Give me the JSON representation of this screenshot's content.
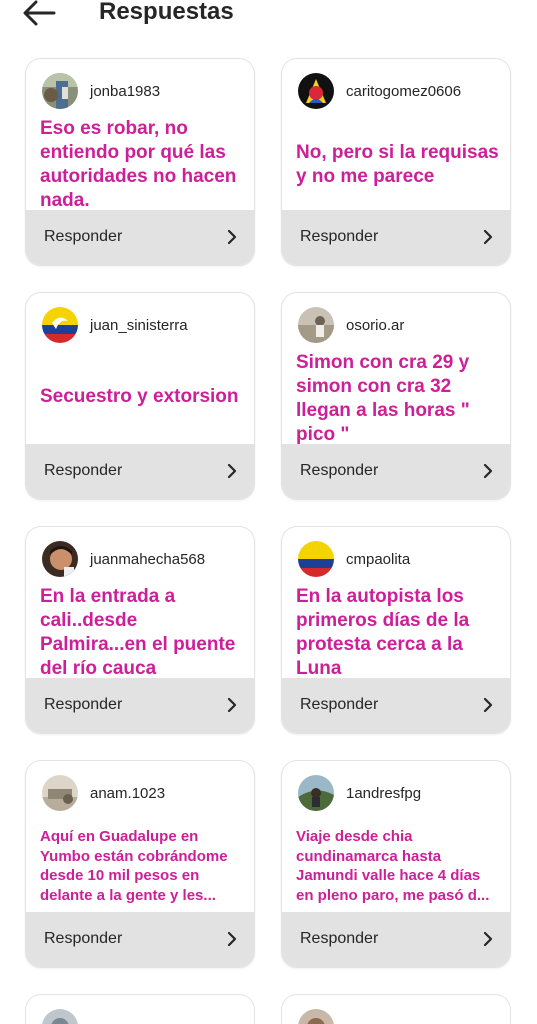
{
  "header": {
    "title": "Respuestas",
    "back_icon": "arrow-left-icon"
  },
  "reply_label": "Responder",
  "accent_color": "#cc1f98",
  "cards": [
    {
      "username": "jonba1983",
      "text": "Eso es robar, no entiendo por qué las autoridades no hacen nada."
    },
    {
      "username": "caritogomez0606",
      "text": "No, pero si la requisas y no me parece"
    },
    {
      "username": "juan_sinisterra",
      "text": "Secuestro y extorsion"
    },
    {
      "username": "osorio.ar",
      "text": "Simon con cra 29 y simon con cra 32 llegan a las horas \" pico \""
    },
    {
      "username": "juanmahecha568",
      "text": "En la entrada a cali..desde Palmira...en el puente del río cauca"
    },
    {
      "username": "cmpaolita",
      "text": "En la autopista los primeros días de la protesta cerca a la Luna"
    },
    {
      "username": "anam.1023",
      "text": "Aquí en Guadalupe en Yumbo están  cobrándome desde 10 mil pesos en delante a la gente y les..."
    },
    {
      "username": "1andresfpg",
      "text": "Viaje desde chia cundinamarca hasta Jamundi valle hace 4 días en pleno paro, me pasó d..."
    }
  ]
}
